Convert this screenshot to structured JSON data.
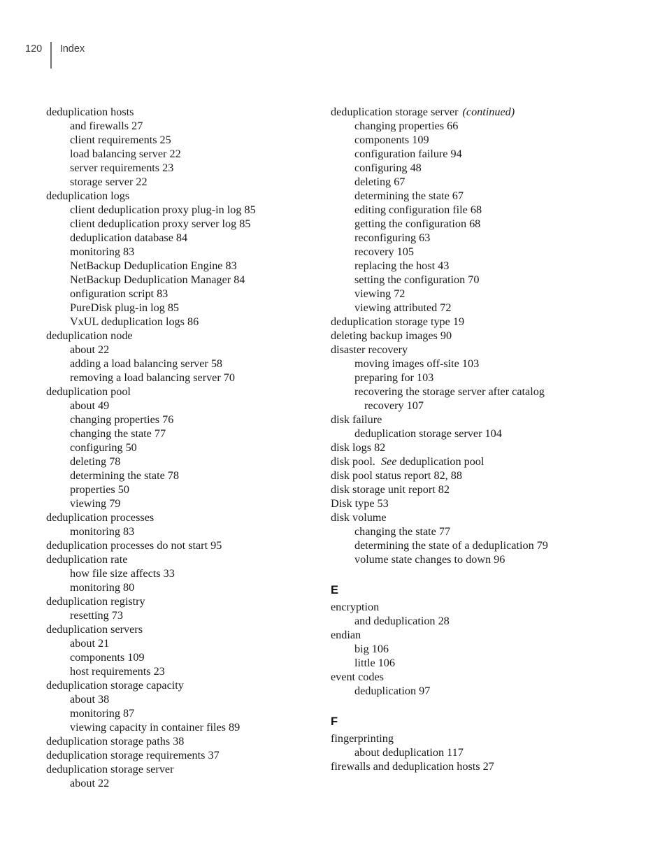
{
  "header": {
    "page_number": "120",
    "label": "Index"
  },
  "columns": {
    "left": [
      {
        "level": 1,
        "text": "deduplication hosts"
      },
      {
        "level": 2,
        "text": "and firewalls  27"
      },
      {
        "level": 2,
        "text": "client requirements  25"
      },
      {
        "level": 2,
        "text": "load balancing server  22"
      },
      {
        "level": 2,
        "text": "server requirements  23"
      },
      {
        "level": 2,
        "text": "storage server  22"
      },
      {
        "level": 1,
        "text": "deduplication logs"
      },
      {
        "level": 2,
        "text": "client deduplication proxy plug-in log  85"
      },
      {
        "level": 2,
        "text": "client deduplication proxy server log  85"
      },
      {
        "level": 2,
        "text": "deduplication database  84"
      },
      {
        "level": 2,
        "text": "monitoring  83"
      },
      {
        "level": 2,
        "text": "NetBackup Deduplication Engine  83"
      },
      {
        "level": 2,
        "text": "NetBackup Deduplication Manager  84"
      },
      {
        "level": 2,
        "text": "onfiguration script  83"
      },
      {
        "level": 2,
        "text": "PureDisk plug-in log  85"
      },
      {
        "level": 2,
        "text": "VxUL deduplication logs  86"
      },
      {
        "level": 1,
        "text": "deduplication node"
      },
      {
        "level": 2,
        "text": "about  22"
      },
      {
        "level": 2,
        "text": "adding a load balancing server  58"
      },
      {
        "level": 2,
        "text": "removing a load balancing server  70"
      },
      {
        "level": 1,
        "text": "deduplication pool"
      },
      {
        "level": 2,
        "text": "about  49"
      },
      {
        "level": 2,
        "text": "changing properties  76"
      },
      {
        "level": 2,
        "text": "changing the state  77"
      },
      {
        "level": 2,
        "text": "configuring  50"
      },
      {
        "level": 2,
        "text": "deleting  78"
      },
      {
        "level": 2,
        "text": "determining the state  78"
      },
      {
        "level": 2,
        "text": "properties  50"
      },
      {
        "level": 2,
        "text": "viewing  79"
      },
      {
        "level": 1,
        "text": "deduplication processes"
      },
      {
        "level": 2,
        "text": "monitoring  83"
      },
      {
        "level": 1,
        "text": "deduplication processes do not start  95"
      },
      {
        "level": 1,
        "text": "deduplication rate"
      },
      {
        "level": 2,
        "text": "how file size affects  33"
      },
      {
        "level": 2,
        "text": "monitoring  80"
      },
      {
        "level": 1,
        "text": "deduplication registry"
      },
      {
        "level": 2,
        "text": "resetting  73"
      },
      {
        "level": 1,
        "text": "deduplication servers"
      },
      {
        "level": 2,
        "text": "about  21"
      },
      {
        "level": 2,
        "text": "components  109"
      },
      {
        "level": 2,
        "text": "host requirements  23"
      },
      {
        "level": 1,
        "text": "deduplication storage capacity"
      },
      {
        "level": 2,
        "text": "about  38"
      },
      {
        "level": 2,
        "text": "monitoring  87"
      },
      {
        "level": 2,
        "text": "viewing capacity in container files  89"
      },
      {
        "level": 1,
        "text": "deduplication storage paths  38"
      },
      {
        "level": 1,
        "text": "deduplication storage requirements  37"
      },
      {
        "level": 1,
        "text": "deduplication storage server"
      },
      {
        "level": 2,
        "text": "about  22"
      }
    ],
    "right": [
      {
        "level": 1,
        "text": "deduplication storage server",
        "note": "(continued)"
      },
      {
        "level": 2,
        "text": "changing properties  66"
      },
      {
        "level": 2,
        "text": "components  109"
      },
      {
        "level": 2,
        "text": "configuration failure  94"
      },
      {
        "level": 2,
        "text": "configuring  48"
      },
      {
        "level": 2,
        "text": "deleting  67"
      },
      {
        "level": 2,
        "text": "determining the state  67"
      },
      {
        "level": 2,
        "text": "editing configuration file  68"
      },
      {
        "level": 2,
        "text": "getting the configuration  68"
      },
      {
        "level": 2,
        "text": "reconfiguring  63"
      },
      {
        "level": 2,
        "text": "recovery  105"
      },
      {
        "level": 2,
        "text": "replacing the host  43"
      },
      {
        "level": 2,
        "text": "setting the configuration  70"
      },
      {
        "level": 2,
        "text": "viewing  72"
      },
      {
        "level": 2,
        "text": "viewing attributed  72"
      },
      {
        "level": 1,
        "text": "deduplication storage type  19"
      },
      {
        "level": 1,
        "text": "deleting backup images  90"
      },
      {
        "level": 1,
        "text": "disaster recovery"
      },
      {
        "level": 2,
        "text": "moving images off-site  103"
      },
      {
        "level": 2,
        "text": "preparing for  103"
      },
      {
        "level": 2,
        "text": "recovering the storage server after catalog"
      },
      {
        "level": 3,
        "text": "recovery  107"
      },
      {
        "level": 1,
        "text": "disk failure"
      },
      {
        "level": 2,
        "text": "deduplication storage server  104"
      },
      {
        "level": 1,
        "text": "disk logs  82"
      },
      {
        "level": 1,
        "text": "disk pool.",
        "see": "See",
        "see_target": "deduplication pool"
      },
      {
        "level": 1,
        "text": "disk pool status report  82, 88"
      },
      {
        "level": 1,
        "text": "disk storage unit report  82"
      },
      {
        "level": 1,
        "text": "Disk type  53"
      },
      {
        "level": 1,
        "text": "disk volume"
      },
      {
        "level": 2,
        "text": "changing the state  77"
      },
      {
        "level": 2,
        "text": "determining the state of a deduplication  79"
      },
      {
        "level": 2,
        "text": "volume state changes to down  96"
      },
      {
        "section": "E"
      },
      {
        "level": 1,
        "text": "encryption"
      },
      {
        "level": 2,
        "text": "and deduplication  28"
      },
      {
        "level": 1,
        "text": "endian"
      },
      {
        "level": 2,
        "text": "big  106"
      },
      {
        "level": 2,
        "text": "little  106"
      },
      {
        "level": 1,
        "text": "event codes"
      },
      {
        "level": 2,
        "text": "deduplication  97"
      },
      {
        "section": "F"
      },
      {
        "level": 1,
        "text": "fingerprinting"
      },
      {
        "level": 2,
        "text": "about deduplication  117"
      },
      {
        "level": 1,
        "text": "firewalls and deduplication hosts  27"
      }
    ]
  }
}
